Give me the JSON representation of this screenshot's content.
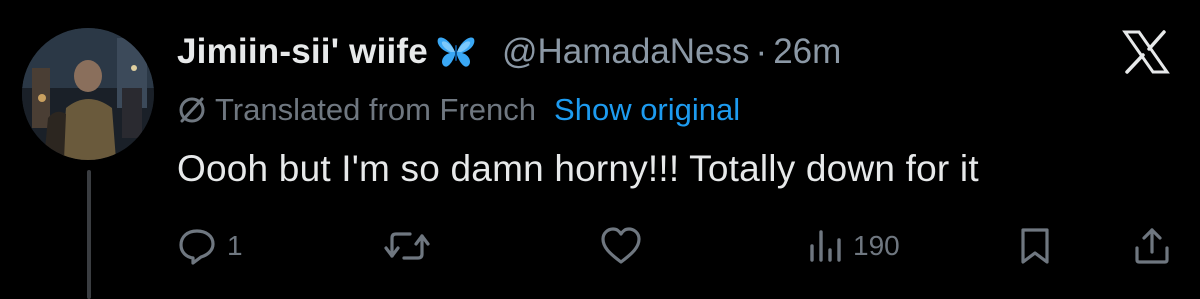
{
  "author": {
    "display_name": "Jimiin-sii' wiife",
    "badge_icon": "butterfly-emoji",
    "handle": "@HamadaNess",
    "separator": "·",
    "time": "26m"
  },
  "translation": {
    "label": "Translated from French",
    "link": "Show original"
  },
  "tweet": {
    "text": "Oooh but I'm so damn horny!!! Totally down for it"
  },
  "actions": {
    "reply_count": "1",
    "repost_count": "",
    "like_count": "",
    "views_count": "190"
  },
  "icons": {
    "reply": "reply-icon",
    "repost": "repost-icon",
    "like": "heart-icon",
    "views": "views-icon",
    "bookmark": "bookmark-icon",
    "share": "share-icon",
    "brand": "x-logo-icon",
    "translate": "translate-icon"
  },
  "colors": {
    "background": "#000000",
    "primary_text": "#e7e9ea",
    "secondary_text": "#8b98a5",
    "muted_text": "#6f7780",
    "link": "#1d9bf0",
    "butterfly": "#3aa8f5",
    "thread_line": "#3a3d41"
  }
}
